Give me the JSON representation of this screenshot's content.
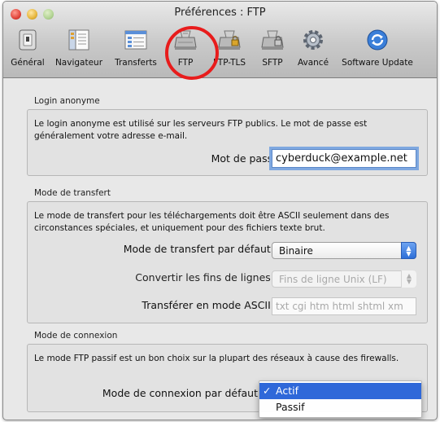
{
  "window": {
    "title": "Préférences : FTP"
  },
  "toolbar": {
    "items": [
      {
        "label": "Général",
        "icon": "general-switch-icon"
      },
      {
        "label": "Navigateur",
        "icon": "browser-icon"
      },
      {
        "label": "Transferts",
        "icon": "transfers-icon"
      },
      {
        "label": "FTP",
        "icon": "ftp-drive-icon",
        "selected": true
      },
      {
        "label": "FTP-TLS",
        "icon": "ftp-tls-drive-icon"
      },
      {
        "label": "SFTP",
        "icon": "sftp-drive-icon"
      },
      {
        "label": "Avancé",
        "icon": "gear-icon"
      },
      {
        "label": "Software Update",
        "icon": "update-icon"
      }
    ]
  },
  "login": {
    "title": "Login anonyme",
    "description": "Le login anonyme est utilisé sur les serveurs FTP publics. Le mot de passe est généralement votre adresse e-mail.",
    "password_label": "Mot de passe :",
    "password_value": "cyberduck@example.net"
  },
  "transfer": {
    "title": "Mode de transfert",
    "description": "Le mode de transfert pour les téléchargements doit être ASCII seulement dans des circonstances spéciales, et uniquement pour des fichiers texte brut.",
    "default_mode_label": "Mode de transfert par défaut :",
    "default_mode_value": "Binaire",
    "line_endings_label": "Convertir les fins de lignes :",
    "line_endings_value": "Fins de ligne Unix (LF)",
    "ascii_label": "Transférer en mode ASCII :",
    "ascii_value": "txt cgi htm html shtml xm"
  },
  "connection": {
    "title": "Mode de connexion",
    "description": "Le mode FTP passif est un bon choix sur la plupart des réseaux à cause des firewalls.",
    "default_mode_label": "Mode de connexion par défaut",
    "menu": {
      "options": [
        "Actif",
        "Passif"
      ],
      "selected": "Actif",
      "check_mark": "✓"
    }
  },
  "colors": {
    "accent": "#2f68d9",
    "annotation_circle": "#e81c1c"
  }
}
